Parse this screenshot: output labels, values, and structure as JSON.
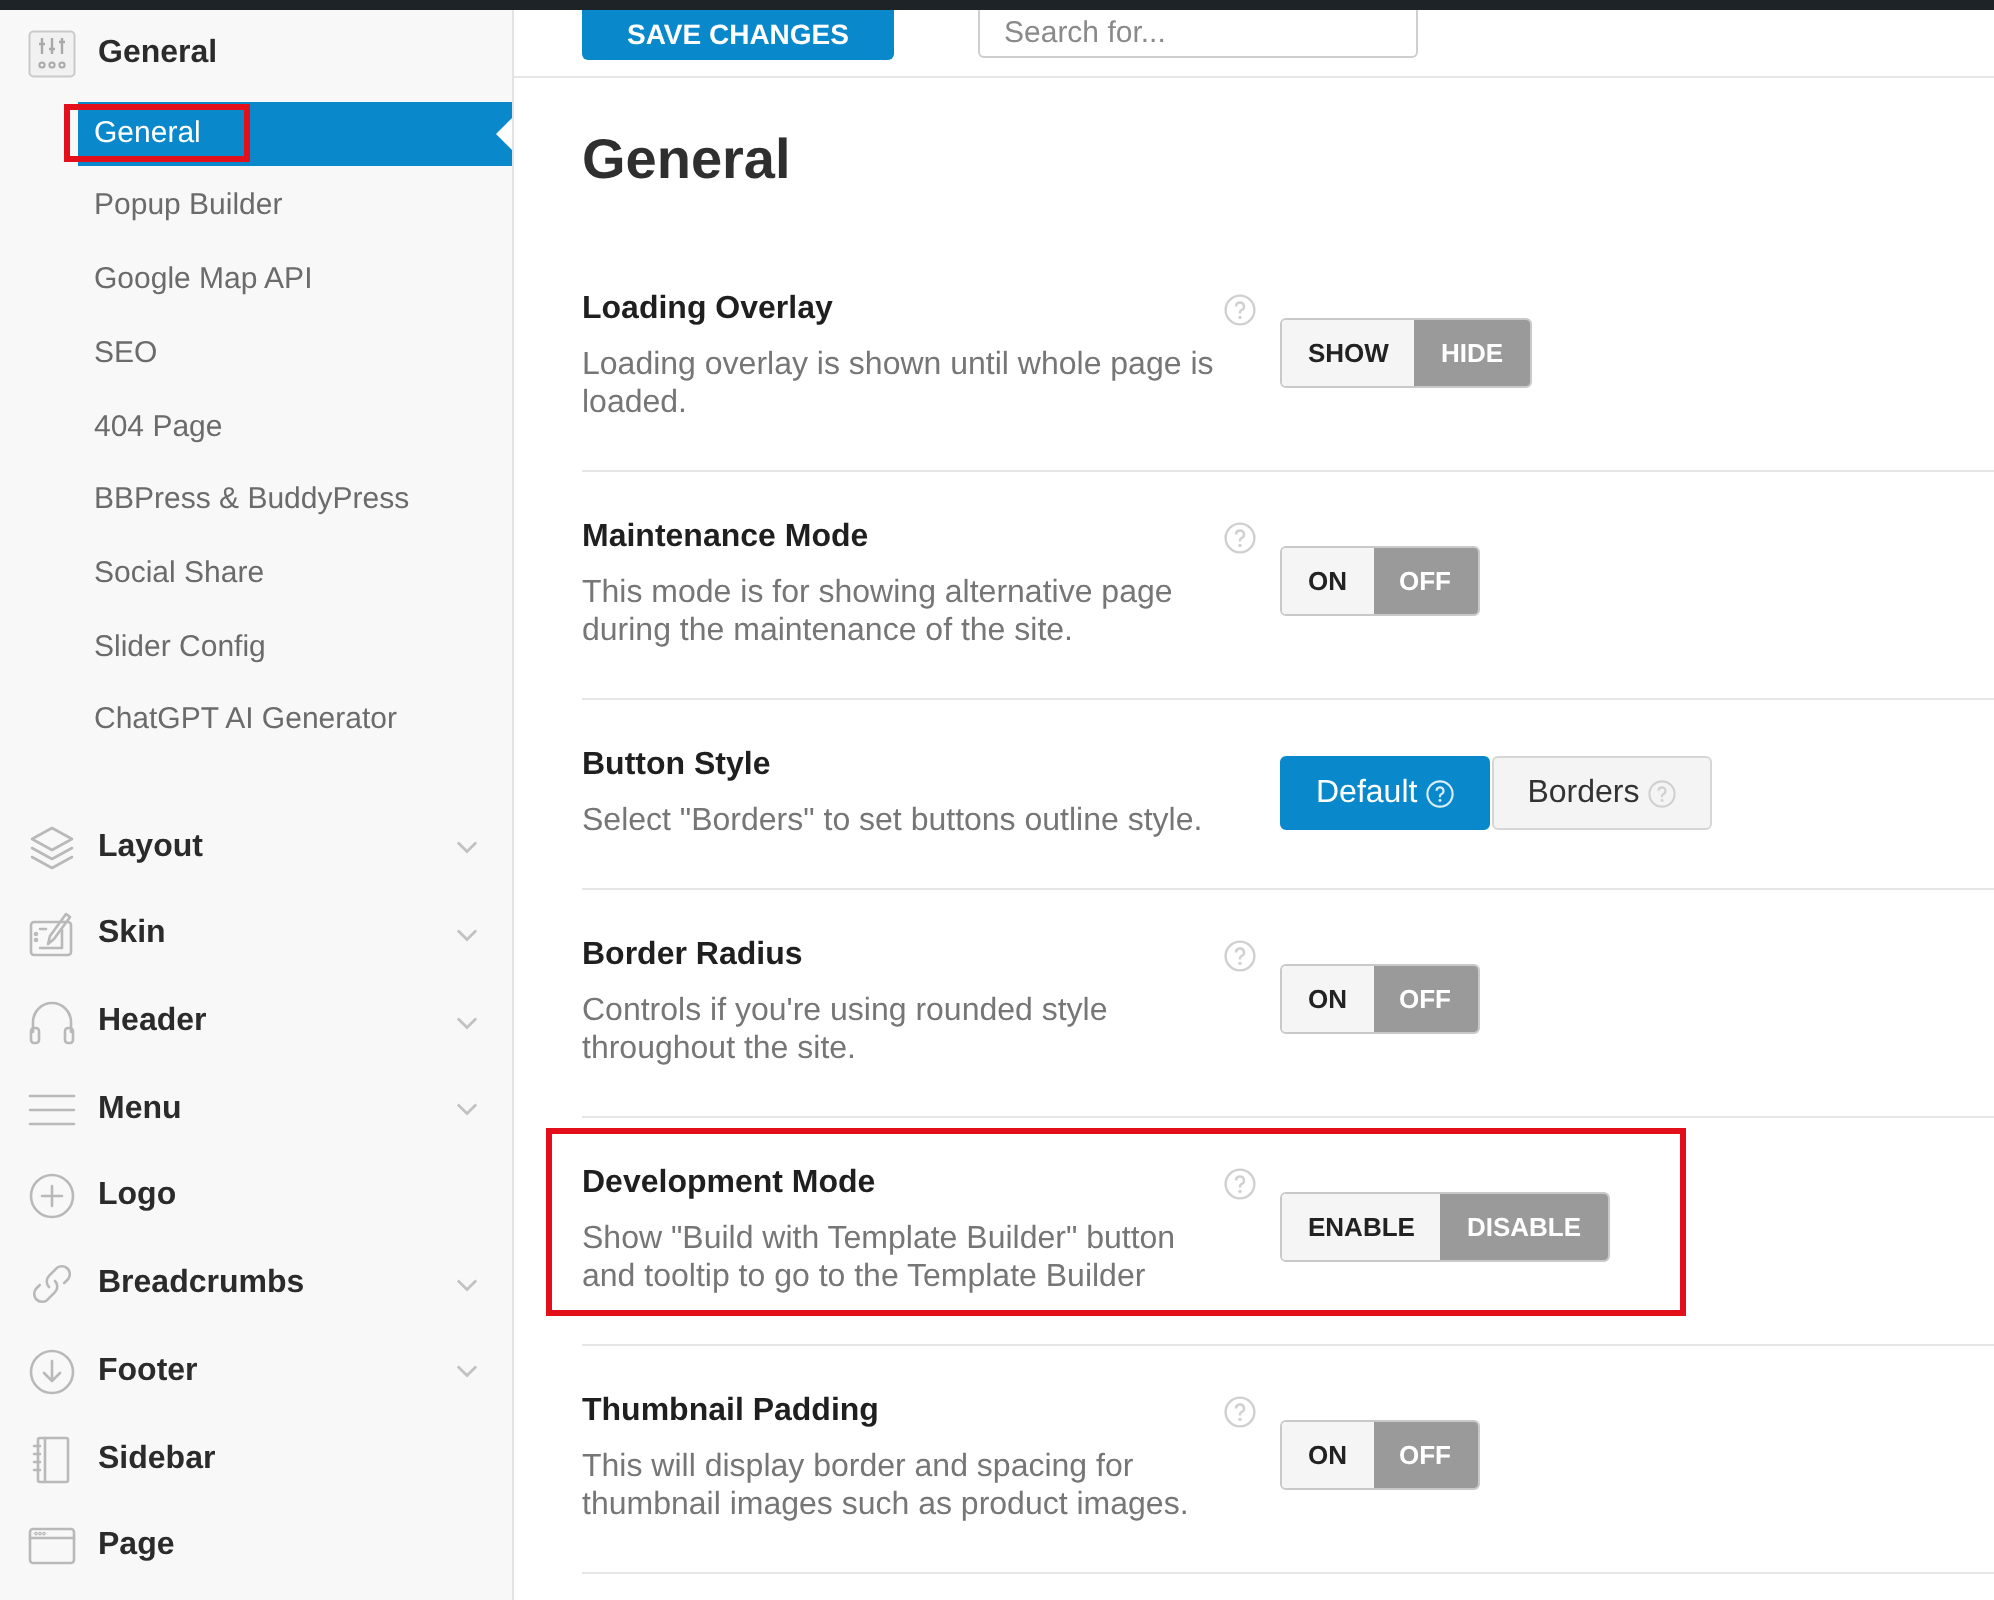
{
  "toolbar": {
    "save_button": "SAVE CHANGES",
    "search": {
      "placeholder": "Search for..."
    }
  },
  "sidebar": {
    "sections": [
      {
        "label": "General",
        "expanded": true,
        "children": [
          {
            "label": "General",
            "selected": true,
            "highlighted": true
          },
          {
            "label": "Popup Builder",
            "selected": false,
            "highlighted": false
          },
          {
            "label": "Google Map API",
            "selected": false,
            "highlighted": false
          },
          {
            "label": "SEO",
            "selected": false,
            "highlighted": false
          },
          {
            "label": "404 Page",
            "selected": false,
            "highlighted": false
          },
          {
            "label": "BBPress & BuddyPress",
            "selected": false,
            "highlighted": false
          },
          {
            "label": "Social Share",
            "selected": false,
            "highlighted": false
          },
          {
            "label": "Slider Config",
            "selected": false,
            "highlighted": false
          },
          {
            "label": "ChatGPT AI Generator",
            "selected": false,
            "highlighted": false
          }
        ]
      },
      {
        "label": "Layout",
        "expanded": false
      },
      {
        "label": "Skin",
        "expanded": false
      },
      {
        "label": "Header",
        "expanded": false
      },
      {
        "label": "Menu",
        "expanded": false
      },
      {
        "label": "Logo"
      },
      {
        "label": "Breadcrumbs",
        "expanded": false
      },
      {
        "label": "Footer",
        "expanded": false
      },
      {
        "label": "Sidebar"
      },
      {
        "label": "Page"
      }
    ]
  },
  "page": {
    "title": "General",
    "settings": [
      {
        "kind": "toggle",
        "title": "Loading Overlay",
        "help": true,
        "description": "Loading overlay is shown until whole page is loaded.",
        "highlighted": false,
        "options": [
          {
            "label": "SHOW",
            "selected": false
          },
          {
            "label": "HIDE",
            "selected": true
          }
        ]
      },
      {
        "kind": "toggle",
        "title": "Maintenance Mode",
        "help": true,
        "description": "This mode is for showing alternative page during the maintenance of the site.",
        "highlighted": false,
        "options": [
          {
            "label": "ON",
            "selected": false
          },
          {
            "label": "OFF",
            "selected": true
          }
        ]
      },
      {
        "kind": "choice",
        "title": "Button Style",
        "help": false,
        "description": "Select \"Borders\" to set buttons outline style.",
        "highlighted": false,
        "options": [
          {
            "label": "Default",
            "selected": true,
            "help": true
          },
          {
            "label": "Borders",
            "selected": false,
            "help": true
          }
        ]
      },
      {
        "kind": "toggle",
        "title": "Border Radius",
        "help": true,
        "description": "Controls if you're using rounded style throughout the site.",
        "highlighted": false,
        "options": [
          {
            "label": "ON",
            "selected": false
          },
          {
            "label": "OFF",
            "selected": true
          }
        ]
      },
      {
        "kind": "toggle",
        "title": "Development Mode",
        "help": true,
        "description": "Show \"Build with Template Builder\" button and tooltip to go to the Template Builder",
        "highlighted": true,
        "options": [
          {
            "label": "ENABLE",
            "selected": false
          },
          {
            "label": "DISABLE",
            "selected": true
          }
        ]
      },
      {
        "kind": "toggle",
        "title": "Thumbnail Padding",
        "help": true,
        "description": "This will display border and spacing for thumbnail images such as product images.",
        "highlighted": false,
        "options": [
          {
            "label": "ON",
            "selected": false
          },
          {
            "label": "OFF",
            "selected": true
          }
        ]
      }
    ]
  }
}
